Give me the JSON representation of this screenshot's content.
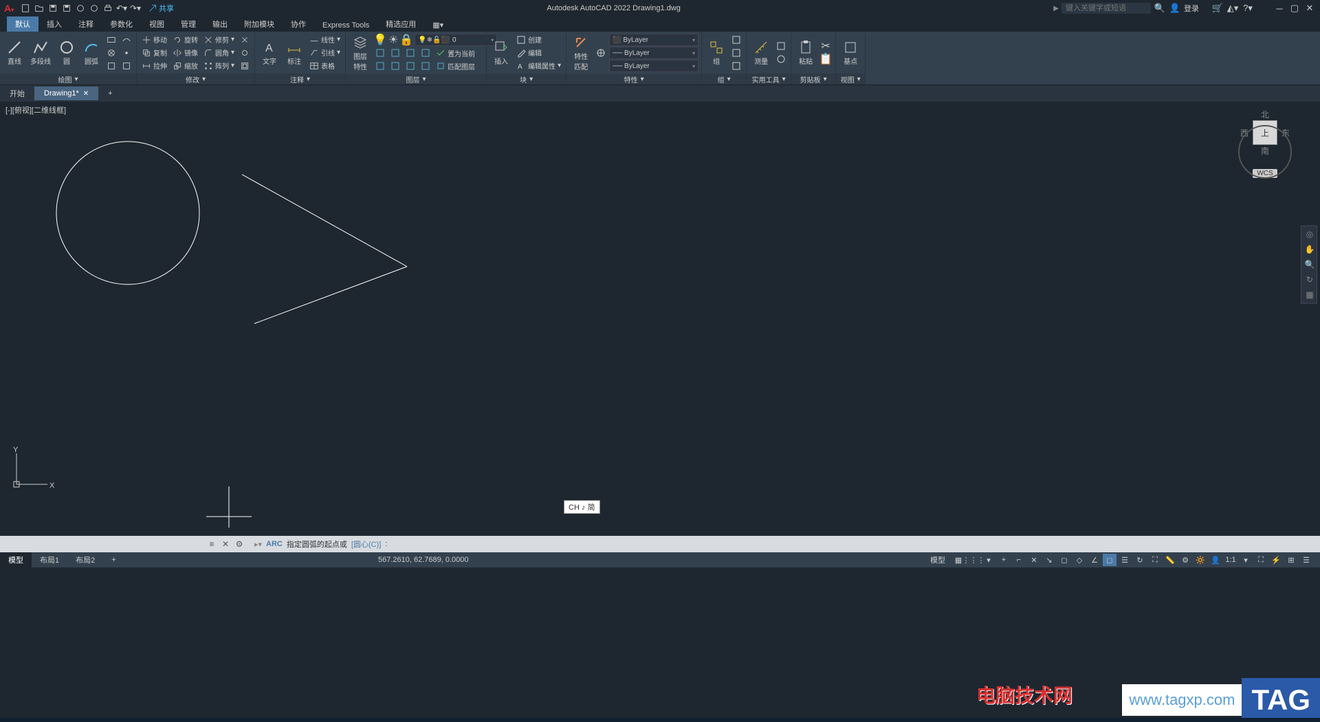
{
  "app": {
    "title": "Autodesk AutoCAD 2022   Drawing1.dwg",
    "share": "共享",
    "login": "登录",
    "search_placeholder": "键入关键字或短语"
  },
  "ribbon_tabs": {
    "t0": "默认",
    "t1": "插入",
    "t2": "注释",
    "t3": "参数化",
    "t4": "视图",
    "t5": "管理",
    "t6": "输出",
    "t7": "附加模块",
    "t8": "协作",
    "t9": "Express Tools",
    "t10": "精选应用"
  },
  "draw": {
    "line": "直线",
    "polyline": "多段线",
    "circle": "圆",
    "arc": "圆弧",
    "title": "绘图"
  },
  "modify": {
    "move": "移动",
    "rotate": "旋转",
    "trim": "修剪",
    "copy": "复制",
    "mirror": "镜像",
    "fillet": "圆角",
    "stretch": "拉伸",
    "scale": "缩放",
    "array": "阵列",
    "title": "修改"
  },
  "annotate": {
    "text": "文字",
    "dim": "标注",
    "linear": "线性",
    "leader": "引线",
    "table": "表格",
    "title": "注释"
  },
  "layers": {
    "props": "图层\n特性",
    "current": "0",
    "make_current": "置为当前",
    "match": "匹配图层",
    "title": "图层"
  },
  "block": {
    "insert": "插入",
    "create": "创建",
    "edit": "编辑",
    "edit_attr": "编辑属性",
    "title": "块"
  },
  "properties": {
    "match": "特性\n匹配",
    "bylayer": "ByLayer",
    "title": "特性"
  },
  "groups": {
    "group": "组",
    "title": "组"
  },
  "utilities": {
    "measure": "测量",
    "title": "实用工具"
  },
  "clipboard": {
    "paste": "粘贴",
    "title": "剪贴板"
  },
  "view": {
    "base": "基点",
    "title": "视图"
  },
  "filetabs": {
    "start": "开始",
    "drawing": "Drawing1*"
  },
  "viewport": {
    "label": "[-][俯视][二维线框]"
  },
  "viewcube": {
    "n": "北",
    "s": "南",
    "e": "东",
    "w": "西",
    "top": "上",
    "wcs": "WCS"
  },
  "cmdline": {
    "cmd": "ARC",
    "prompt": "指定圆弧的起点或",
    "opt": "[圆心(C)]",
    "cursor": ":"
  },
  "ime": {
    "text": "CH ♪ 简"
  },
  "layout_tabs": {
    "model": "模型",
    "l1": "布局1",
    "l2": "布局2"
  },
  "status": {
    "coords": "567.2610, 62.7689, 0.0000",
    "model": "模型"
  },
  "watermark": {
    "text1": "电脑技术网",
    "tag": "TAG",
    "url": "www.tagxp.com"
  }
}
